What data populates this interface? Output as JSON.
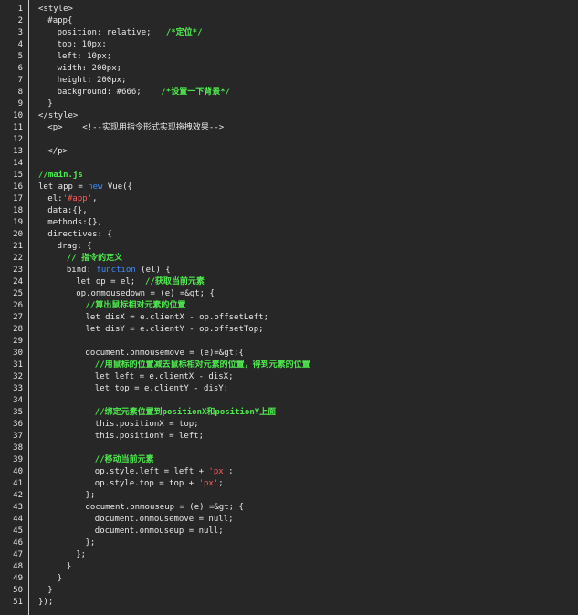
{
  "colors": {
    "background": "#272727",
    "text": "#e8e8e8",
    "comment": "#4ee94e",
    "keyword": "#3c8cff",
    "string": "#ff5a5a",
    "gutter_border": "#cfcfcf"
  },
  "lines": [
    {
      "n": "1",
      "indent": 0,
      "tokens": [
        {
          "t": "<style>",
          "k": "plain"
        }
      ]
    },
    {
      "n": "2",
      "indent": 1,
      "tokens": [
        {
          "t": "#app{",
          "k": "plain"
        }
      ]
    },
    {
      "n": "3",
      "indent": 2,
      "tokens": [
        {
          "t": "position: relative;   ",
          "k": "plain"
        },
        {
          "t": "/*定位*/",
          "k": "comment"
        }
      ]
    },
    {
      "n": "4",
      "indent": 2,
      "tokens": [
        {
          "t": "top: 10px;",
          "k": "plain"
        }
      ]
    },
    {
      "n": "5",
      "indent": 2,
      "tokens": [
        {
          "t": "left: 10px;",
          "k": "plain"
        }
      ]
    },
    {
      "n": "6",
      "indent": 2,
      "tokens": [
        {
          "t": "width: 200px;",
          "k": "plain"
        }
      ]
    },
    {
      "n": "7",
      "indent": 2,
      "tokens": [
        {
          "t": "height: 200px;",
          "k": "plain"
        }
      ]
    },
    {
      "n": "8",
      "indent": 2,
      "tokens": [
        {
          "t": "background: #666;    ",
          "k": "plain"
        },
        {
          "t": "/*设置一下背景*/",
          "k": "comment"
        }
      ]
    },
    {
      "n": "9",
      "indent": 1,
      "tokens": [
        {
          "t": "}",
          "k": "plain"
        }
      ]
    },
    {
      "n": "10",
      "indent": 0,
      "tokens": [
        {
          "t": "</style>",
          "k": "plain"
        }
      ]
    },
    {
      "n": "11",
      "indent": 1,
      "tokens": [
        {
          "t": "<p>    <!--实现用指令形式实现拖拽效果-->",
          "k": "plain"
        }
      ]
    },
    {
      "n": "12",
      "indent": 0,
      "tokens": []
    },
    {
      "n": "13",
      "indent": 1,
      "tokens": [
        {
          "t": "</p>",
          "k": "plain"
        }
      ]
    },
    {
      "n": "14",
      "indent": 0,
      "tokens": []
    },
    {
      "n": "15",
      "indent": 0,
      "tokens": [
        {
          "t": "//main.js",
          "k": "comment"
        }
      ]
    },
    {
      "n": "16",
      "indent": 0,
      "tokens": [
        {
          "t": "let app = ",
          "k": "plain"
        },
        {
          "t": "new",
          "k": "keyword"
        },
        {
          "t": " Vue({",
          "k": "plain"
        }
      ]
    },
    {
      "n": "17",
      "indent": 1,
      "tokens": [
        {
          "t": "el:",
          "k": "plain"
        },
        {
          "t": "'#app'",
          "k": "string"
        },
        {
          "t": ",",
          "k": "plain"
        }
      ]
    },
    {
      "n": "18",
      "indent": 1,
      "tokens": [
        {
          "t": "data:{},",
          "k": "plain"
        }
      ]
    },
    {
      "n": "19",
      "indent": 1,
      "tokens": [
        {
          "t": "methods:{},",
          "k": "plain"
        }
      ]
    },
    {
      "n": "20",
      "indent": 1,
      "tokens": [
        {
          "t": "directives: {",
          "k": "plain"
        }
      ]
    },
    {
      "n": "21",
      "indent": 2,
      "tokens": [
        {
          "t": "drag: {",
          "k": "plain"
        }
      ]
    },
    {
      "n": "22",
      "indent": 3,
      "tokens": [
        {
          "t": "// 指令的定义",
          "k": "comment"
        }
      ]
    },
    {
      "n": "23",
      "indent": 3,
      "tokens": [
        {
          "t": "bind: ",
          "k": "plain"
        },
        {
          "t": "function",
          "k": "keyword"
        },
        {
          "t": " (el) {",
          "k": "plain"
        }
      ]
    },
    {
      "n": "24",
      "indent": 4,
      "tokens": [
        {
          "t": "let op = el;  ",
          "k": "plain"
        },
        {
          "t": "//获取当前元素",
          "k": "comment"
        }
      ]
    },
    {
      "n": "25",
      "indent": 4,
      "tokens": [
        {
          "t": "op.onmousedown = (e) =&gt; {",
          "k": "plain"
        }
      ]
    },
    {
      "n": "26",
      "indent": 5,
      "tokens": [
        {
          "t": "//算出鼠标相对元素的位置",
          "k": "comment"
        }
      ]
    },
    {
      "n": "27",
      "indent": 5,
      "tokens": [
        {
          "t": "let disX = e.clientX - op.offsetLeft;",
          "k": "plain"
        }
      ]
    },
    {
      "n": "28",
      "indent": 5,
      "tokens": [
        {
          "t": "let disY = e.clientY - op.offsetTop;",
          "k": "plain"
        }
      ]
    },
    {
      "n": "29",
      "indent": 0,
      "tokens": []
    },
    {
      "n": "30",
      "indent": 5,
      "tokens": [
        {
          "t": "document.onmousemove = (e)=&gt;{",
          "k": "plain"
        }
      ]
    },
    {
      "n": "31",
      "indent": 6,
      "tokens": [
        {
          "t": "//用鼠标的位置减去鼠标相对元素的位置，得到元素的位置",
          "k": "comment"
        }
      ]
    },
    {
      "n": "32",
      "indent": 6,
      "tokens": [
        {
          "t": "let left = e.clientX - disX;",
          "k": "plain"
        }
      ]
    },
    {
      "n": "33",
      "indent": 6,
      "tokens": [
        {
          "t": "let top = e.clientY - disY;",
          "k": "plain"
        }
      ]
    },
    {
      "n": "34",
      "indent": 0,
      "tokens": []
    },
    {
      "n": "35",
      "indent": 6,
      "tokens": [
        {
          "t": "//绑定元素位置到positionX和positionY上面",
          "k": "comment"
        }
      ]
    },
    {
      "n": "36",
      "indent": 6,
      "tokens": [
        {
          "t": "this.positionX = top;",
          "k": "plain"
        }
      ]
    },
    {
      "n": "37",
      "indent": 6,
      "tokens": [
        {
          "t": "this.positionY = left;",
          "k": "plain"
        }
      ]
    },
    {
      "n": "38",
      "indent": 0,
      "tokens": []
    },
    {
      "n": "39",
      "indent": 6,
      "tokens": [
        {
          "t": "//移动当前元素",
          "k": "comment"
        }
      ]
    },
    {
      "n": "40",
      "indent": 6,
      "tokens": [
        {
          "t": "op.style.left = left + ",
          "k": "plain"
        },
        {
          "t": "'px'",
          "k": "string"
        },
        {
          "t": ";",
          "k": "plain"
        }
      ]
    },
    {
      "n": "41",
      "indent": 6,
      "tokens": [
        {
          "t": "op.style.top = top + ",
          "k": "plain"
        },
        {
          "t": "'px'",
          "k": "string"
        },
        {
          "t": ";",
          "k": "plain"
        }
      ]
    },
    {
      "n": "42",
      "indent": 5,
      "tokens": [
        {
          "t": "};",
          "k": "plain"
        }
      ]
    },
    {
      "n": "43",
      "indent": 5,
      "tokens": [
        {
          "t": "document.onmouseup = (e) =&gt; {",
          "k": "plain"
        }
      ]
    },
    {
      "n": "44",
      "indent": 6,
      "tokens": [
        {
          "t": "document.onmousemove = null;",
          "k": "plain"
        }
      ]
    },
    {
      "n": "45",
      "indent": 6,
      "tokens": [
        {
          "t": "document.onmouseup = null;",
          "k": "plain"
        }
      ]
    },
    {
      "n": "46",
      "indent": 5,
      "tokens": [
        {
          "t": "};",
          "k": "plain"
        }
      ]
    },
    {
      "n": "47",
      "indent": 4,
      "tokens": [
        {
          "t": "};",
          "k": "plain"
        }
      ]
    },
    {
      "n": "48",
      "indent": 3,
      "tokens": [
        {
          "t": "}",
          "k": "plain"
        }
      ]
    },
    {
      "n": "49",
      "indent": 2,
      "tokens": [
        {
          "t": "}",
          "k": "plain"
        }
      ]
    },
    {
      "n": "50",
      "indent": 1,
      "tokens": [
        {
          "t": "}",
          "k": "plain"
        }
      ]
    },
    {
      "n": "51",
      "indent": 0,
      "tokens": [
        {
          "t": "});",
          "k": "plain"
        }
      ]
    }
  ]
}
